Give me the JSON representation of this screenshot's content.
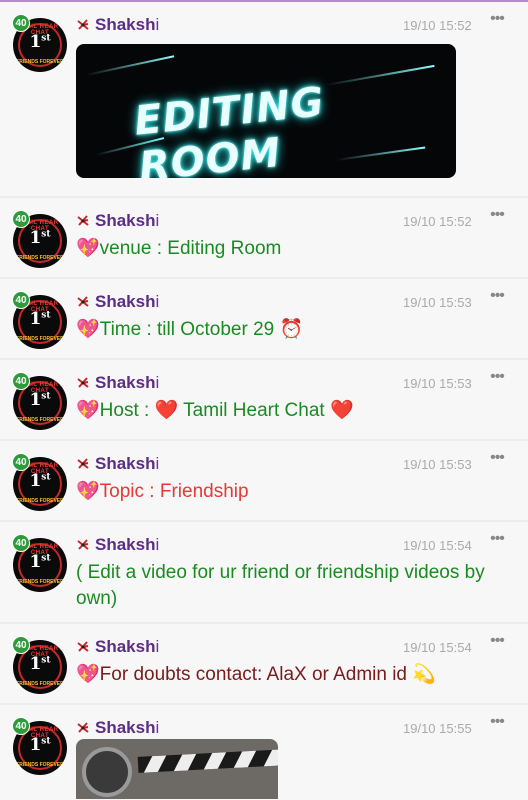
{
  "messages": [
    {
      "badge": "40",
      "sender_first": "Shaksh",
      "sender_last": "i",
      "time": "19/10 15:52",
      "type": "image",
      "image_title": "EDITING ROOM"
    },
    {
      "badge": "40",
      "sender_first": "Shaksh",
      "sender_last": "i",
      "time": "19/10 15:52",
      "type": "text",
      "emoji": "💖",
      "text": "venue : Editing Room"
    },
    {
      "badge": "40",
      "sender_first": "Shaksh",
      "sender_last": "i",
      "time": "19/10 15:53",
      "type": "text",
      "emoji": "💖",
      "text": "Time : till October 29 ⏰"
    },
    {
      "badge": "40",
      "sender_first": "Shaksh",
      "sender_last": "i",
      "time": "19/10 15:53",
      "type": "text",
      "emoji": "💖",
      "text_a": "Host : ",
      "heart_a": "❤️",
      "text_b": " Tamil Heart Chat ",
      "heart_b": "❤️"
    },
    {
      "badge": "40",
      "sender_first": "Shaksh",
      "sender_last": "i",
      "time": "19/10 15:53",
      "type": "text",
      "emoji": "💖",
      "text": "Topic : Friendship"
    },
    {
      "badge": "40",
      "sender_first": "Shaksh",
      "sender_last": "i",
      "time": "19/10 15:54",
      "type": "text",
      "text": "( Edit a video for ur friend or friendship videos by own)"
    },
    {
      "badge": "40",
      "sender_first": "Shaksh",
      "sender_last": "i",
      "time": "19/10 15:54",
      "type": "text",
      "emoji": "💖",
      "text": "For doubts contact: AlaX or Admin id 💫"
    },
    {
      "badge": "40",
      "sender_first": "Shaksh",
      "sender_last": "i",
      "time": "19/10 15:55",
      "type": "image"
    }
  ],
  "avatar": {
    "top_text": "TAMIL HEART CHAT",
    "center": "1",
    "center_sup": "st",
    "bottom_text": "FRIENDS FOREVER"
  },
  "icons": {
    "menu": "more-dots-icon",
    "star": "star-badge-icon"
  },
  "colors": {
    "name": "#5c2d84",
    "green_text": "#1b8a22",
    "red_text": "#e53935",
    "maroon_text": "#7a1b1b",
    "badge": "#2e9b3a"
  }
}
